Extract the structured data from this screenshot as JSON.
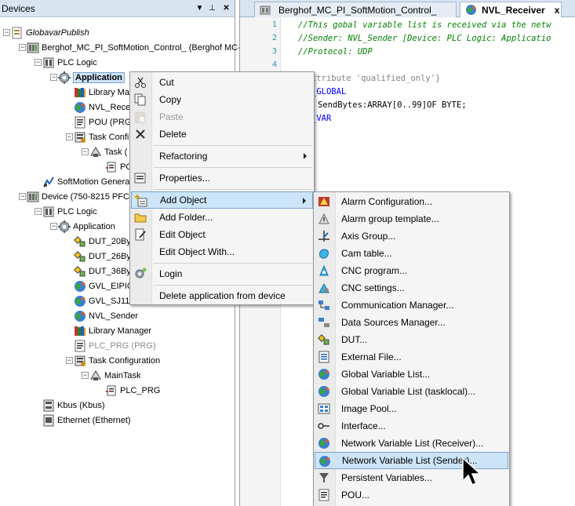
{
  "devices_panel": {
    "title": "Devices",
    "tree": [
      {
        "label": "GlobavarPublish",
        "icon": "project-icon",
        "italic": true
      },
      {
        "label": "Berghof_MC_PI_SoftMotion_Control_ (Berghof MC-",
        "icon": "plc-device-icon"
      },
      {
        "label": "PLC Logic",
        "icon": "plc-logic-icon"
      },
      {
        "label": "Application",
        "icon": "application-gear-icon",
        "selected": true
      },
      {
        "label": "Library Ma",
        "icon": "library-icon"
      },
      {
        "label": "NVL_Recei",
        "icon": "globe-icon"
      },
      {
        "label": "POU (PRG)",
        "icon": "pou-icon"
      },
      {
        "label": "Task Confi",
        "icon": "task-config-icon"
      },
      {
        "label": "Task (",
        "icon": "task-icon"
      },
      {
        "label": "PO",
        "icon": "pou-call-icon"
      },
      {
        "label": "SoftMotion Genera",
        "icon": "softmotion-icon"
      },
      {
        "label": "Device (750-8215 PFC2",
        "icon": "plc-device-icon"
      },
      {
        "label": "PLC Logic",
        "icon": "plc-logic-icon"
      },
      {
        "label": "Application",
        "icon": "application-gear-icon"
      },
      {
        "label": "DUT_20By",
        "icon": "dut-icon"
      },
      {
        "label": "DUT_26By",
        "icon": "dut-icon"
      },
      {
        "label": "DUT_36By",
        "icon": "dut-icon"
      },
      {
        "label": "GVL_EIPIC",
        "icon": "globe-icon"
      },
      {
        "label": "GVL_SJ11D",
        "icon": "globe-icon"
      },
      {
        "label": "NVL_Sender",
        "icon": "globe-icon"
      },
      {
        "label": "Library Manager",
        "icon": "library-icon"
      },
      {
        "label": "PLC_PRG (PRG)",
        "icon": "pou-icon",
        "grey": true
      },
      {
        "label": "Task Configuration",
        "icon": "task-config-icon"
      },
      {
        "label": "MainTask",
        "icon": "task-icon"
      },
      {
        "label": "PLC_PRG",
        "icon": "pou-call-icon"
      },
      {
        "label": "Kbus (Kbus)",
        "icon": "kbus-icon"
      },
      {
        "label": "Ethernet (Ethernet)",
        "icon": "ethernet-icon"
      }
    ]
  },
  "editor": {
    "tabs": [
      {
        "label": "Berghof_MC_PI_SoftMotion_Control_",
        "active": false
      },
      {
        "label": "NVL_Receiver",
        "active": true,
        "close": "x"
      }
    ],
    "line_numbers": [
      "1",
      "2",
      "3",
      "4"
    ],
    "lines": [
      "//This gobal variable list is received via the netw",
      "//Sender: NVL_Sender [Device: PLC Logic: Applicatio",
      "//Protocol: UDP",
      "",
      "ttribute 'qualified_only'}",
      "_GLOBAL",
      "SendBytes:ARRAY[0..99]OF BYTE;",
      "_VAR"
    ]
  },
  "context_menu": {
    "items": [
      {
        "label": "Cut",
        "icon": "scissors-icon"
      },
      {
        "label": "Copy",
        "icon": "copy-icon"
      },
      {
        "label": "Paste",
        "icon": "paste-icon",
        "disabled": true
      },
      {
        "label": "Delete",
        "icon": "delete-x-icon"
      },
      {
        "label": "Refactoring",
        "submenu": true
      },
      {
        "label": "Properties...",
        "icon": "properties-icon"
      },
      {
        "label": "Add Object",
        "icon": "add-object-icon",
        "submenu": true,
        "highlighted": true
      },
      {
        "label": "Add Folder...",
        "icon": "folder-icon"
      },
      {
        "label": "Edit Object",
        "icon": "edit-object-icon"
      },
      {
        "label": "Edit Object With..."
      },
      {
        "label": "Login",
        "icon": "login-icon"
      },
      {
        "label": "Delete application from device"
      }
    ]
  },
  "submenu": {
    "items": [
      {
        "label": "Alarm Configuration...",
        "icon": "alarm-config-icon"
      },
      {
        "label": "Alarm group template...",
        "icon": "alarm-group-icon"
      },
      {
        "label": "Axis Group...",
        "icon": "axis-group-icon"
      },
      {
        "label": "Cam table...",
        "icon": "cam-table-icon"
      },
      {
        "label": "CNC program...",
        "icon": "cnc-program-icon"
      },
      {
        "label": "CNC settings...",
        "icon": "cnc-settings-icon"
      },
      {
        "label": "Communication Manager...",
        "icon": "comm-manager-icon"
      },
      {
        "label": "Data Sources Manager...",
        "icon": "data-sources-icon"
      },
      {
        "label": "DUT...",
        "icon": "dut-icon"
      },
      {
        "label": "External File...",
        "icon": "external-file-icon"
      },
      {
        "label": "Global Variable List...",
        "icon": "globe-icon"
      },
      {
        "label": "Global Variable List (tasklocal)...",
        "icon": "globe-icon"
      },
      {
        "label": "Image Pool...",
        "icon": "image-pool-icon"
      },
      {
        "label": "Interface...",
        "icon": "interface-icon"
      },
      {
        "label": "Network Variable List (Receiver)...",
        "icon": "globe-icon"
      },
      {
        "label": "Network Variable List (Sender)...",
        "icon": "globe-icon",
        "highlighted": true
      },
      {
        "label": "Persistent Variables...",
        "icon": "persistent-icon"
      },
      {
        "label": "POU...",
        "icon": "pou-icon"
      }
    ]
  },
  "colors": {
    "panel_header": "#d9e4f1",
    "selection": "#cce4f7",
    "selection_border": "#7da2ce",
    "comment": "#008000",
    "keyword": "#0000ff"
  }
}
